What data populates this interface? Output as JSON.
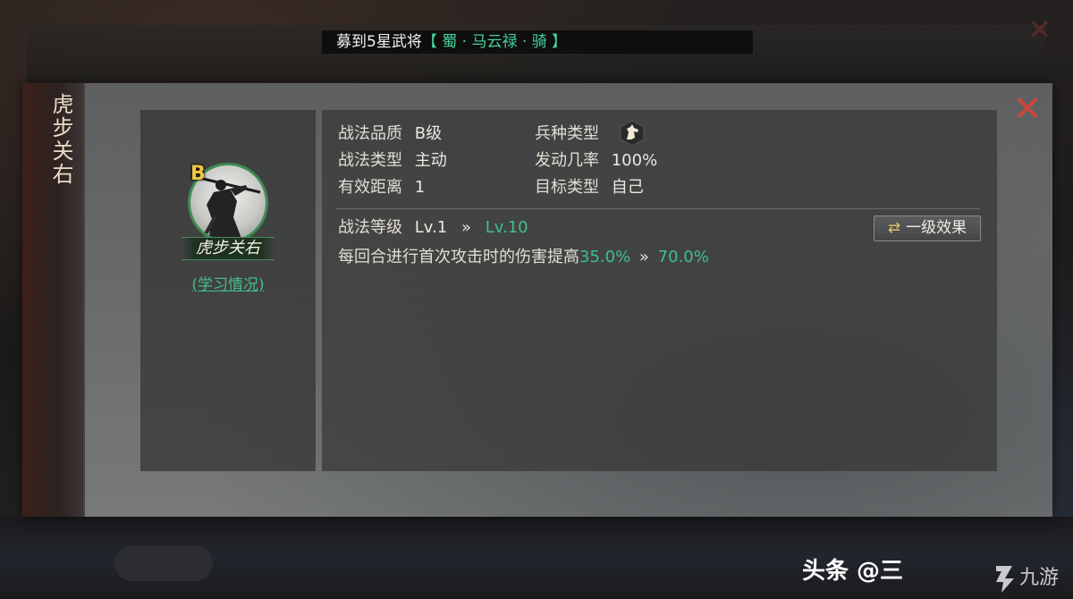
{
  "ticker": {
    "prefix": "募到5星武将",
    "highlight": "【 蜀 · 马云禄 · 骑 】"
  },
  "dialog": {
    "side_title": "虎步关右",
    "close_icon": "close-x-icon"
  },
  "skill": {
    "grade": "B",
    "name": "虎步关右",
    "learn_link": "(学习情况)"
  },
  "details": {
    "quality_label": "战法品质",
    "quality_value": "B级",
    "troop_label": "兵种类型",
    "troop_icon": "cavalry-horse-icon",
    "type_label": "战法类型",
    "type_value": "主动",
    "rate_label": "发动几率",
    "rate_value": "100%",
    "range_label": "有效距离",
    "range_value": "1",
    "target_label": "目标类型",
    "target_value": "自己"
  },
  "level": {
    "label": "战法等级",
    "from": "Lv.1",
    "arrow": "»",
    "to": "Lv.10"
  },
  "effect": {
    "text": "每回合进行首次攻击时的伤害提高",
    "from": "35.0%",
    "arrow": "»",
    "to": "70.0%"
  },
  "switch_button": {
    "icon": "⇄",
    "label": "一级效果"
  },
  "watermark": {
    "text": "头条 @三",
    "logo_text": "九游"
  },
  "colors": {
    "accent_green": "#3fc08a",
    "grade_gold": "#f0c542",
    "close_red": "#c9483c"
  }
}
